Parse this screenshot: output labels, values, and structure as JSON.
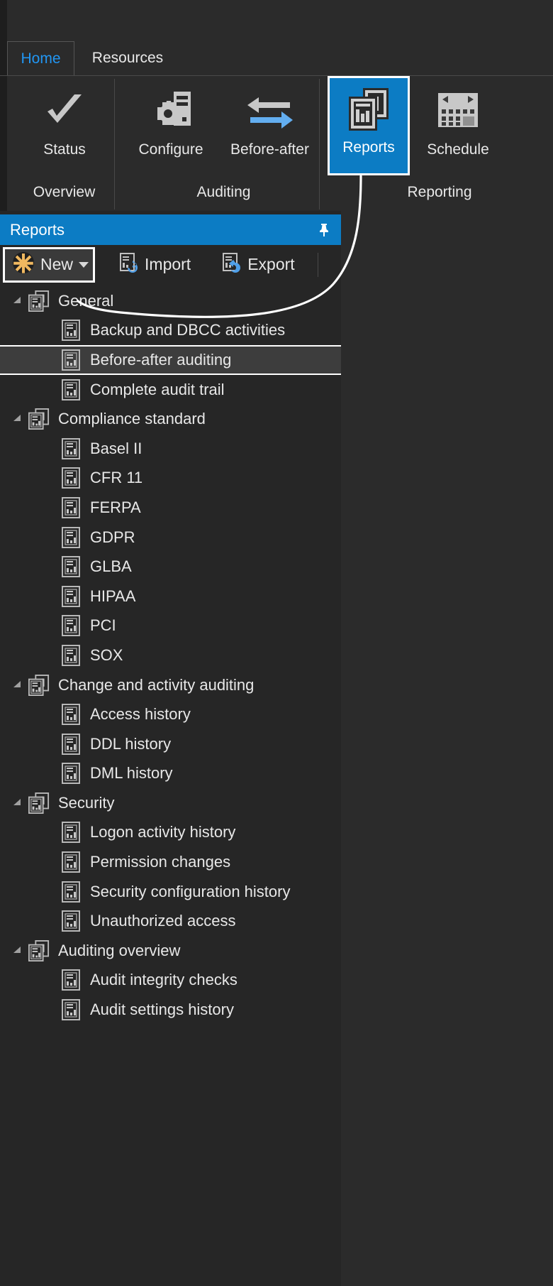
{
  "window": {
    "tabs": [
      {
        "label": "Home",
        "active": true,
        "name": "tab-home"
      },
      {
        "label": "Resources",
        "active": false,
        "name": "tab-resources"
      }
    ]
  },
  "ribbon": {
    "buttons": [
      {
        "label": "Status",
        "icon": "checkmark-icon",
        "selected": false
      },
      {
        "label": "Configure",
        "icon": "gear-server-icon",
        "selected": false
      },
      {
        "label": "Before-after",
        "icon": "two-arrows-icon",
        "selected": false
      },
      {
        "label": "Reports",
        "icon": "reports-stack-icon",
        "selected": true
      },
      {
        "label": "Schedule",
        "icon": "calendar-icon",
        "selected": false
      }
    ],
    "groups": [
      {
        "label": "Overview"
      },
      {
        "label": "Auditing"
      },
      {
        "label": "Reporting"
      }
    ]
  },
  "panel": {
    "title": "Reports",
    "pin_icon": "pin-icon",
    "accent_color": "#0c7cc4",
    "toolbar": {
      "new_label": "New",
      "new_icon": "asterisk-burst-icon",
      "new_has_dropdown": true,
      "import_label": "Import",
      "import_icon": "import-document-icon",
      "export_label": "Export",
      "export_icon": "export-document-icon"
    },
    "tree": [
      {
        "type": "group",
        "label": "General",
        "expanded": true,
        "icon": "report-group-icon"
      },
      {
        "type": "leaf",
        "label": "Backup and DBCC activities",
        "selected": false,
        "icon": "report-icon"
      },
      {
        "type": "leaf",
        "label": "Before-after auditing",
        "selected": true,
        "icon": "report-icon"
      },
      {
        "type": "leaf",
        "label": "Complete audit trail",
        "selected": false,
        "icon": "report-icon"
      },
      {
        "type": "group",
        "label": "Compliance standard",
        "expanded": true,
        "icon": "report-group-icon"
      },
      {
        "type": "leaf",
        "label": "Basel II",
        "selected": false,
        "icon": "report-icon"
      },
      {
        "type": "leaf",
        "label": "CFR 11",
        "selected": false,
        "icon": "report-icon"
      },
      {
        "type": "leaf",
        "label": "FERPA",
        "selected": false,
        "icon": "report-icon"
      },
      {
        "type": "leaf",
        "label": "GDPR",
        "selected": false,
        "icon": "report-icon"
      },
      {
        "type": "leaf",
        "label": "GLBA",
        "selected": false,
        "icon": "report-icon"
      },
      {
        "type": "leaf",
        "label": "HIPAA",
        "selected": false,
        "icon": "report-icon"
      },
      {
        "type": "leaf",
        "label": "PCI",
        "selected": false,
        "icon": "report-icon"
      },
      {
        "type": "leaf",
        "label": "SOX",
        "selected": false,
        "icon": "report-icon"
      },
      {
        "type": "group",
        "label": "Change and activity auditing",
        "expanded": true,
        "icon": "report-group-icon"
      },
      {
        "type": "leaf",
        "label": "Access history",
        "selected": false,
        "icon": "report-icon"
      },
      {
        "type": "leaf",
        "label": "DDL history",
        "selected": false,
        "icon": "report-icon"
      },
      {
        "type": "leaf",
        "label": "DML history",
        "selected": false,
        "icon": "report-icon"
      },
      {
        "type": "group",
        "label": "Security",
        "expanded": true,
        "icon": "report-group-icon"
      },
      {
        "type": "leaf",
        "label": "Logon activity history",
        "selected": false,
        "icon": "report-icon"
      },
      {
        "type": "leaf",
        "label": "Permission changes",
        "selected": false,
        "icon": "report-icon"
      },
      {
        "type": "leaf",
        "label": "Security configuration history",
        "selected": false,
        "icon": "report-icon"
      },
      {
        "type": "leaf",
        "label": "Unauthorized access",
        "selected": false,
        "icon": "report-icon"
      },
      {
        "type": "group",
        "label": "Auditing overview",
        "expanded": true,
        "icon": "report-group-icon"
      },
      {
        "type": "leaf",
        "label": "Audit integrity checks",
        "selected": false,
        "icon": "report-icon"
      },
      {
        "type": "leaf",
        "label": "Audit settings history",
        "selected": false,
        "icon": "report-icon"
      }
    ]
  },
  "annotation": {
    "type": "callout-curve",
    "color": "#ffffff",
    "from": "Reports ribbon button",
    "to": "New button in Reports panel toolbar"
  }
}
